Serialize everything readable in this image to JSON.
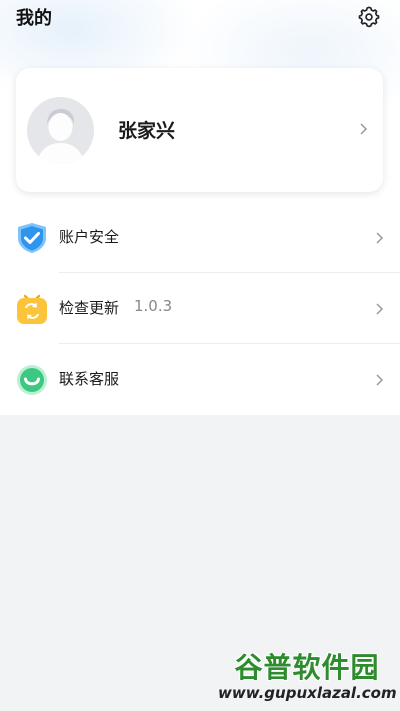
{
  "header": {
    "title": "我的",
    "settings_icon": "gear-icon"
  },
  "profile": {
    "name": "张家兴",
    "avatar_icon": "default-avatar-icon"
  },
  "menu": [
    {
      "label": "账户安全",
      "value": "",
      "icon": "shield-check-icon",
      "color": "#3aa0f0"
    },
    {
      "label": "检查更新",
      "value": "1.0.3",
      "icon": "update-refresh-icon",
      "color": "#f7b51c"
    },
    {
      "label": "联系客服",
      "value": "",
      "icon": "customer-service-icon",
      "color": "#35c47a"
    }
  ],
  "watermark": {
    "title": "谷普软件园",
    "url": "www.gupuxlazal.com"
  },
  "colors": {
    "background": "#f2f3f5",
    "card": "#ffffff",
    "accent_blue": "#3aa0f0",
    "accent_yellow": "#f7b51c",
    "accent_green": "#35c47a"
  }
}
